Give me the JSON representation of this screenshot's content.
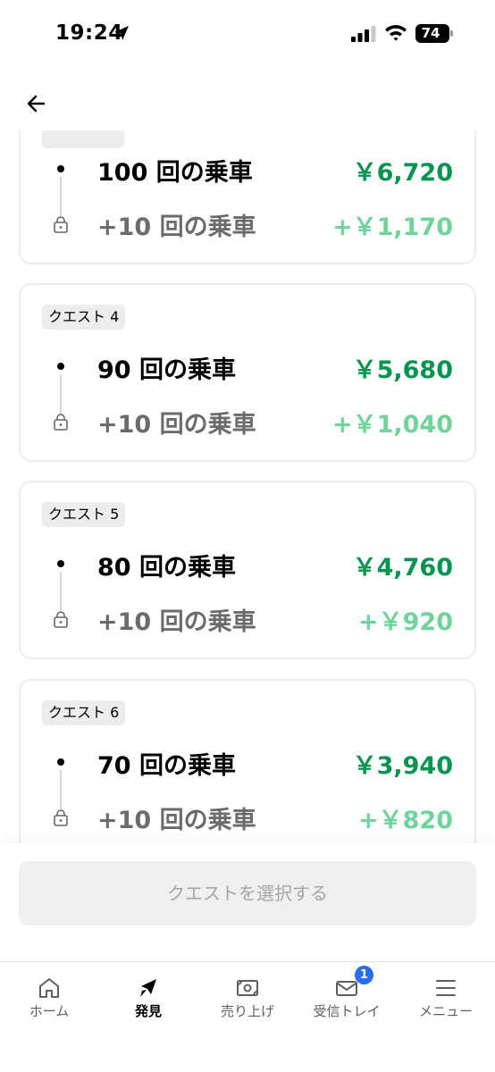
{
  "status_bar": {
    "time": "19:24",
    "battery": "74",
    "icons": [
      "location-arrow-icon",
      "cellular-signal-icon",
      "wifi-icon",
      "battery-icon"
    ]
  },
  "header": {
    "back_icon": "arrow-left-icon"
  },
  "quests": [
    {
      "badge": "",
      "main_label": "100 回の乗車",
      "main_value": "￥6,720",
      "extra_label": "+10 回の乗車",
      "extra_value": "+￥1,170"
    },
    {
      "badge": "クエスト 4",
      "main_label": "90 回の乗車",
      "main_value": "￥5,680",
      "extra_label": "+10 回の乗車",
      "extra_value": "+￥1,040"
    },
    {
      "badge": "クエスト 5",
      "main_label": "80 回の乗車",
      "main_value": "￥4,760",
      "extra_label": "+10 回の乗車",
      "extra_value": "+￥920"
    },
    {
      "badge": "クエスト 6",
      "main_label": "70 回の乗車",
      "main_value": "￥3,940",
      "extra_label": "+10 回の乗車",
      "extra_value": "+￥820"
    }
  ],
  "select_button": {
    "label": "クエストを選択する"
  },
  "tab_bar": {
    "tabs": [
      {
        "label": "ホーム",
        "icon": "home-icon",
        "active": false
      },
      {
        "label": "発見",
        "icon": "compass-icon",
        "active": true
      },
      {
        "label": "売り上げ",
        "icon": "earnings-icon",
        "active": false
      },
      {
        "label": "受信トレイ",
        "icon": "mail-icon",
        "active": false,
        "badge": "1"
      },
      {
        "label": "メニュー",
        "icon": "menu-icon",
        "active": false
      }
    ]
  },
  "colors": {
    "accent_green": "#05944f",
    "light_green": "#6fd39b",
    "notification_blue": "#276ef1"
  }
}
